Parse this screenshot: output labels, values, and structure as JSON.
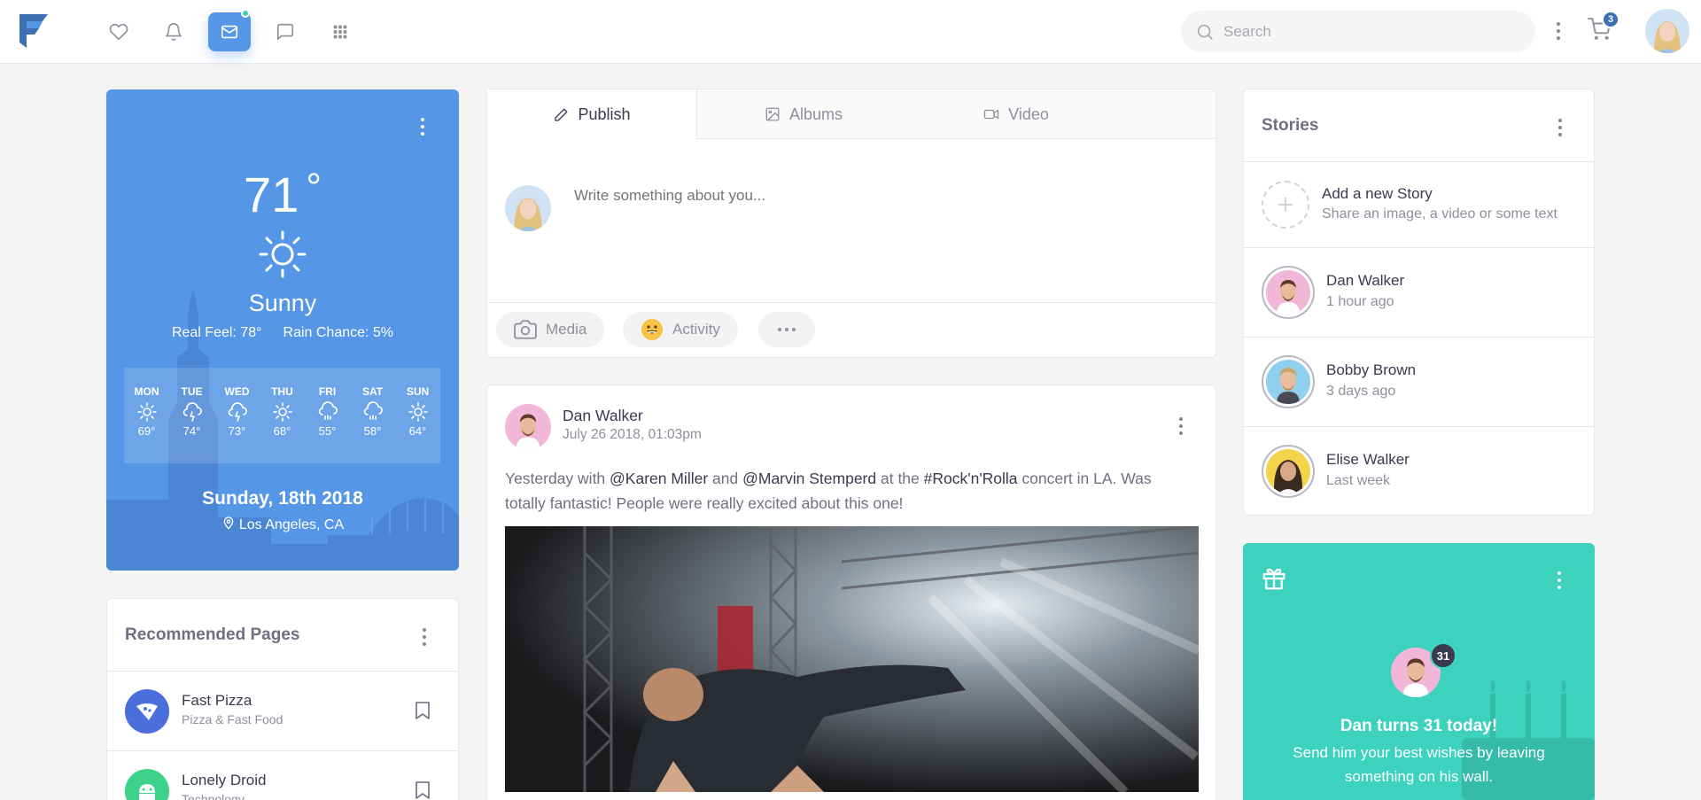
{
  "navbar": {
    "icons": [
      "heart-icon",
      "bell-icon",
      "mail-icon",
      "chat-icon",
      "apps-icon"
    ],
    "search_placeholder": "Search",
    "cart_count": "3",
    "accent": "#5596e6",
    "notification_color": "#3dd2bd"
  },
  "weather": {
    "temperature": "71",
    "degree": "°",
    "condition": "Sunny",
    "real_feel": "Real Feel: 78°",
    "rain_chance": "Rain Chance: 5%",
    "forecast": [
      {
        "day": "MON",
        "icon": "sun-icon",
        "temp": "69°"
      },
      {
        "day": "TUE",
        "icon": "storm-icon",
        "temp": "74°"
      },
      {
        "day": "WED",
        "icon": "storm-icon",
        "temp": "73°"
      },
      {
        "day": "THU",
        "icon": "sun-icon",
        "temp": "68°"
      },
      {
        "day": "FRI",
        "icon": "rain-icon",
        "temp": "55°"
      },
      {
        "day": "SAT",
        "icon": "rain-icon",
        "temp": "58°"
      },
      {
        "day": "SUN",
        "icon": "sun-icon",
        "temp": "64°"
      }
    ],
    "date": "Sunday, 18th 2018",
    "location": "Los Angeles, CA",
    "color": "#5596e6"
  },
  "recommended": {
    "title": "Recommended Pages",
    "pages": [
      {
        "name": "Fast Pizza",
        "category": "Pizza & Fast Food",
        "color": "#4a6fdc"
      },
      {
        "name": "Lonely Droid",
        "category": "Technology",
        "color": "#3dd28a"
      }
    ]
  },
  "compose": {
    "tabs": [
      {
        "label": "Publish",
        "icon": "pencil-icon"
      },
      {
        "label": "Albums",
        "icon": "image-icon"
      },
      {
        "label": "Video",
        "icon": "video-icon"
      }
    ],
    "placeholder": "Write something about you...",
    "actions": [
      {
        "label": "Media",
        "icon": "camera-icon"
      },
      {
        "label": "Activity",
        "icon": "smiley-icon"
      }
    ]
  },
  "post": {
    "author": "Dan Walker",
    "timestamp": "July 26 2018, 01:03pm",
    "text_parts": [
      "Yesterday with ",
      "@Karen Miller",
      " and ",
      "@Marvin Stemperd",
      " at the ",
      "#Rock'n'Rolla",
      " concert in LA. Was totally fantastic! People were really excited about this one!"
    ]
  },
  "stories": {
    "title": "Stories",
    "add_title": "Add a new Story",
    "add_subtitle": "Share an image, a video or some text",
    "items": [
      {
        "name": "Dan Walker",
        "time": "1 hour ago"
      },
      {
        "name": "Bobby Brown",
        "time": "3 days ago"
      },
      {
        "name": "Elise Walker",
        "time": "Last week"
      }
    ]
  },
  "birthday": {
    "age": "31",
    "title": "Dan turns 31 today!",
    "message": "Send him your best wishes by leaving something on his wall.",
    "color": "#3dd2bd"
  }
}
